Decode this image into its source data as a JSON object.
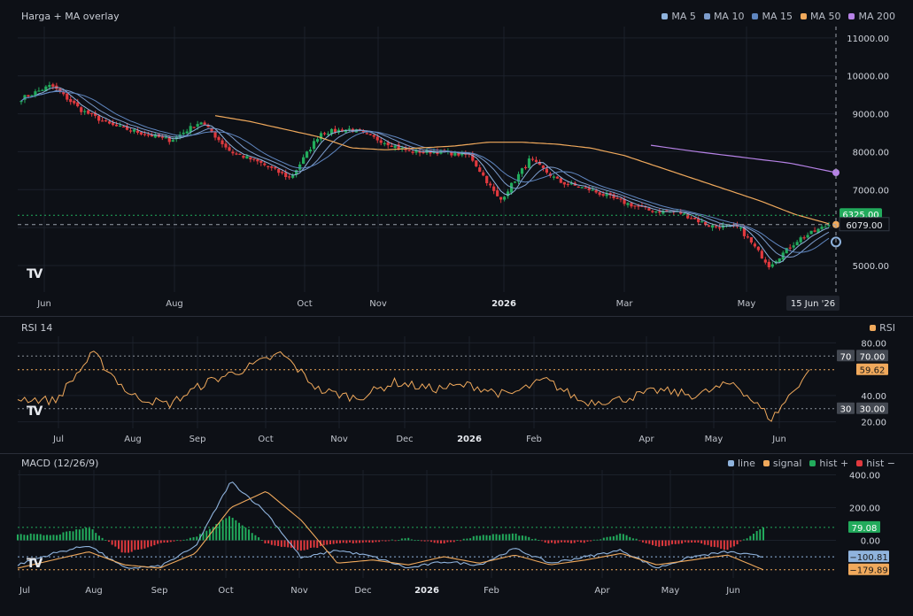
{
  "panels": {
    "price": {
      "title": "Harga + MA overlay",
      "legend": [
        {
          "name": "MA 5",
          "color": "#8fb3dd"
        },
        {
          "name": "MA 10",
          "color": "#7c9ccc"
        },
        {
          "name": "MA 15",
          "color": "#5f86c0"
        },
        {
          "name": "MA 50",
          "color": "#f0a95c"
        },
        {
          "name": "MA 200",
          "color": "#b682e6"
        }
      ],
      "y_ticks": [
        "11000.00",
        "10000.00",
        "9000.00",
        "8000.00",
        "7000.00",
        "5000.00"
      ],
      "x_ticks": [
        "Jun",
        "Aug",
        "Oct",
        "Nov",
        "2026",
        "Mar",
        "May"
      ],
      "crosshair_date": "15 Jun '26",
      "crosshair_price": "6079.00",
      "last_price_badge": "6325.00",
      "ylim": [
        4300,
        11300
      ]
    },
    "rsi": {
      "title": "RSI 14",
      "legend": [
        {
          "name": "RSI",
          "color": "#f0a95c"
        }
      ],
      "y_ticks": [
        "80.00",
        "40.00",
        "20.00"
      ],
      "level_70_label": "70",
      "level_70_value": "70.00",
      "level_30_label": "30",
      "level_30_value": "30.00",
      "current_value": "59.62",
      "x_ticks": [
        "Jul",
        "Aug",
        "Sep",
        "Oct",
        "Nov",
        "Dec",
        "2026",
        "Feb",
        "Apr",
        "May",
        "Jun"
      ],
      "ylim": [
        15,
        85
      ]
    },
    "macd": {
      "title": "MACD (12/26/9)",
      "legend": [
        {
          "name": "line",
          "color": "#8fb3dd"
        },
        {
          "name": "signal",
          "color": "#f0a95c"
        },
        {
          "name": "hist +",
          "color": "#22ab5c"
        },
        {
          "name": "hist −",
          "color": "#e0393e"
        }
      ],
      "y_ticks": [
        "400.00",
        "200.00",
        "0.00"
      ],
      "hist_value": "79.08",
      "line_value": "−100.81",
      "signal_value": "−179.89",
      "x_ticks": [
        "Jul",
        "Aug",
        "Sep",
        "Oct",
        "Nov",
        "Dec",
        "2026",
        "Feb",
        "Apr",
        "May",
        "Jun"
      ],
      "ylim": [
        -230,
        430
      ]
    }
  },
  "chart_data": [
    {
      "type": "line",
      "name": "price",
      "title": "Harga + MA overlay",
      "x": [
        "2025-05-27",
        "2025-06-15",
        "2025-07-10",
        "2025-08-01",
        "2025-08-20",
        "2025-09-10",
        "2025-10-01",
        "2025-10-15",
        "2025-10-25",
        "2025-11-10",
        "2025-12-01",
        "2025-12-20",
        "2026-01-10",
        "2026-01-25",
        "2026-02-05",
        "2026-02-10",
        "2026-02-25",
        "2026-03-15",
        "2026-04-05",
        "2026-04-25",
        "2026-05-05",
        "2026-05-15",
        "2026-05-30",
        "2026-06-08",
        "2026-06-13",
        "2026-06-16"
      ],
      "series": [
        {
          "name": "Close",
          "values": [
            9400,
            9750,
            9100,
            8700,
            8500,
            8300,
            8800,
            8000,
            7700,
            7300,
            8500,
            8600,
            8300,
            8000,
            8000,
            7900,
            6700,
            7800,
            7200,
            7000,
            6700,
            6450,
            6400,
            6050,
            6000,
            5000,
            5700,
            6079
          ]
        },
        {
          "name": "MA 50",
          "values": [
            null,
            null,
            null,
            8950,
            8800,
            8600,
            8400,
            8100,
            8050,
            8100,
            8150,
            8250,
            8250,
            8200,
            8100,
            7900,
            7600,
            7300,
            7000,
            6700,
            6350,
            6100
          ]
        },
        {
          "name": "MA 200",
          "values": [
            8170,
            8000,
            7850,
            7700,
            7450
          ]
        }
      ],
      "ylim": [
        4300,
        11300
      ]
    },
    {
      "type": "line",
      "name": "RSI 14",
      "title": "RSI 14",
      "x": [
        "Jul",
        "Aug",
        "Sep",
        "Oct",
        "Nov",
        "Dec",
        "2026",
        "Feb",
        "Apr",
        "May",
        "Jun"
      ],
      "values": [
        38,
        36,
        72,
        40,
        33,
        50,
        60,
        72,
        44,
        38,
        50,
        45,
        48,
        40,
        52,
        35,
        37,
        44,
        40,
        50,
        22,
        59.62
      ],
      "levels": [
        70,
        30
      ],
      "ylim": [
        15,
        85
      ]
    },
    {
      "type": "bar",
      "name": "MACD (12/26/9)",
      "title": "MACD (12/26/9)",
      "x": [
        "Jul",
        "Aug",
        "Sep",
        "Oct",
        "Nov",
        "Dec",
        "2026",
        "Feb",
        "Apr",
        "May",
        "Jun"
      ],
      "series": [
        {
          "name": "line",
          "values": [
            -150,
            -80,
            -30,
            -170,
            -160,
            -40,
            360,
            170,
            -110,
            -60,
            -100,
            -170,
            -130,
            -150,
            -50,
            -140,
            -100,
            -60,
            -170,
            -100,
            -70,
            -100.81
          ]
        },
        {
          "name": "signal",
          "values": [
            -170,
            -120,
            -70,
            -150,
            -170,
            -80,
            200,
            300,
            120,
            -140,
            -120,
            -150,
            -100,
            -140,
            -90,
            -150,
            -120,
            -80,
            -150,
            -120,
            -90,
            -179.89
          ]
        },
        {
          "name": "hist",
          "values": [
            40,
            30,
            80,
            -80,
            -20,
            20,
            150,
            -20,
            -60,
            -20,
            -10,
            10,
            -20,
            30,
            40,
            -20,
            -10,
            40,
            -40,
            -10,
            -60,
            79.08
          ]
        }
      ],
      "ylim": [
        -230,
        430
      ]
    }
  ]
}
